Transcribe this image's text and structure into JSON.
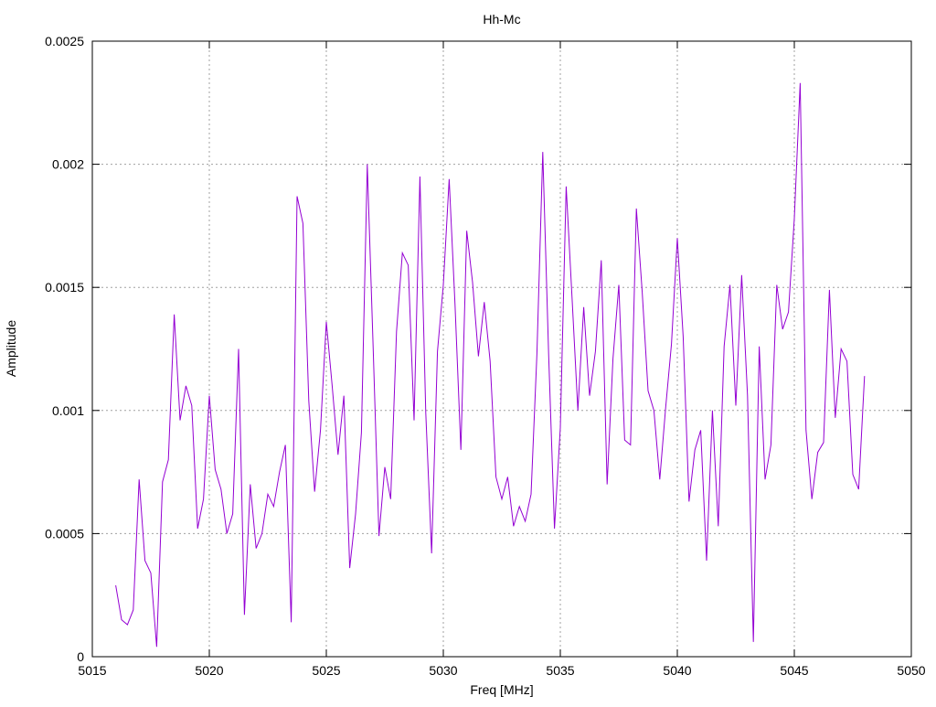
{
  "chart_data": {
    "type": "line",
    "title": "Hh-Mc",
    "xlabel": "Freq [MHz]",
    "ylabel": "Amplitude",
    "xlim": [
      5015,
      5050
    ],
    "ylim": [
      0,
      0.0025
    ],
    "xticks": [
      5015,
      5020,
      5025,
      5030,
      5035,
      5040,
      5045,
      5050
    ],
    "xtick_labels": [
      "5015",
      "5020",
      "5025",
      "5030",
      "5035",
      "5040",
      "5045",
      "5050"
    ],
    "yticks": [
      0,
      0.0005,
      0.001,
      0.0015,
      0.002,
      0.0025
    ],
    "ytick_labels": [
      "0",
      "0.0005",
      "0.001",
      "0.0015",
      "0.002",
      "0.0025"
    ],
    "grid": true,
    "legend": "none",
    "series": [
      {
        "color": "#9400d3",
        "x": [
          5016.0,
          5016.25,
          5016.5,
          5016.75,
          5017.0,
          5017.25,
          5017.5,
          5017.75,
          5018.0,
          5018.25,
          5018.5,
          5018.75,
          5019.0,
          5019.25,
          5019.5,
          5019.75,
          5020.0,
          5020.25,
          5020.5,
          5020.75,
          5021.0,
          5021.25,
          5021.5,
          5021.75,
          5022.0,
          5022.25,
          5022.5,
          5022.75,
          5023.0,
          5023.25,
          5023.5,
          5023.75,
          5024.0,
          5024.25,
          5024.5,
          5024.75,
          5025.0,
          5025.25,
          5025.5,
          5025.75,
          5026.0,
          5026.25,
          5026.5,
          5026.75,
          5027.0,
          5027.25,
          5027.5,
          5027.75,
          5028.0,
          5028.25,
          5028.5,
          5028.75,
          5029.0,
          5029.25,
          5029.5,
          5029.75,
          5030.0,
          5030.25,
          5030.5,
          5030.75,
          5031.0,
          5031.25,
          5031.5,
          5031.75,
          5032.0,
          5032.25,
          5032.5,
          5032.75,
          5033.0,
          5033.25,
          5033.5,
          5033.75,
          5034.0,
          5034.25,
          5034.5,
          5034.75,
          5035.0,
          5035.25,
          5035.5,
          5035.75,
          5036.0,
          5036.25,
          5036.5,
          5036.75,
          5037.0,
          5037.25,
          5037.5,
          5037.75,
          5038.0,
          5038.25,
          5038.5,
          5038.75,
          5039.0,
          5039.25,
          5039.5,
          5039.75,
          5040.0,
          5040.25,
          5040.5,
          5040.75,
          5041.0,
          5041.25,
          5041.5,
          5041.75,
          5042.0,
          5042.25,
          5042.5,
          5042.75,
          5043.0,
          5043.25,
          5043.5,
          5043.75,
          5044.0,
          5044.25,
          5044.5,
          5044.75,
          5045.0,
          5045.25,
          5045.5,
          5045.75,
          5046.0,
          5046.25,
          5046.5,
          5046.75,
          5047.0,
          5047.25,
          5047.5,
          5047.75,
          5048.0
        ],
        "y": [
          0.00029,
          0.00015,
          0.00013,
          0.00019,
          0.00072,
          0.00039,
          0.00034,
          4e-05,
          0.00071,
          0.0008,
          0.00139,
          0.00096,
          0.0011,
          0.00102,
          0.00052,
          0.00064,
          0.00106,
          0.00076,
          0.00068,
          0.0005,
          0.00058,
          0.00125,
          0.00017,
          0.0007,
          0.00044,
          0.0005,
          0.00066,
          0.00061,
          0.00075,
          0.00086,
          0.00014,
          0.00187,
          0.00176,
          0.00104,
          0.00067,
          0.00092,
          0.00136,
          0.0011,
          0.00082,
          0.00106,
          0.00036,
          0.00058,
          0.00091,
          0.002,
          0.00126,
          0.00049,
          0.00077,
          0.00064,
          0.00132,
          0.00164,
          0.00159,
          0.00096,
          0.00195,
          0.00099,
          0.00042,
          0.00124,
          0.00151,
          0.00194,
          0.00143,
          0.00084,
          0.00173,
          0.00152,
          0.00122,
          0.00144,
          0.0012,
          0.00073,
          0.00064,
          0.00073,
          0.00053,
          0.00061,
          0.00055,
          0.00066,
          0.00123,
          0.00205,
          0.00123,
          0.00052,
          0.00093,
          0.00191,
          0.00146,
          0.001,
          0.00142,
          0.00106,
          0.00124,
          0.00161,
          0.0007,
          0.00121,
          0.00151,
          0.00088,
          0.00086,
          0.00182,
          0.00148,
          0.00108,
          0.001,
          0.00072,
          0.00101,
          0.00127,
          0.0017,
          0.0013,
          0.00063,
          0.00084,
          0.00092,
          0.00039,
          0.001,
          0.00053,
          0.00126,
          0.00151,
          0.00102,
          0.00155,
          0.00106,
          6e-05,
          0.00126,
          0.00072,
          0.00086,
          0.00151,
          0.00133,
          0.0014,
          0.00178,
          0.00233,
          0.00092,
          0.00064,
          0.00083,
          0.00087,
          0.00149,
          0.00097,
          0.00125,
          0.0012,
          0.00074,
          0.00068,
          0.00114
        ]
      }
    ]
  }
}
